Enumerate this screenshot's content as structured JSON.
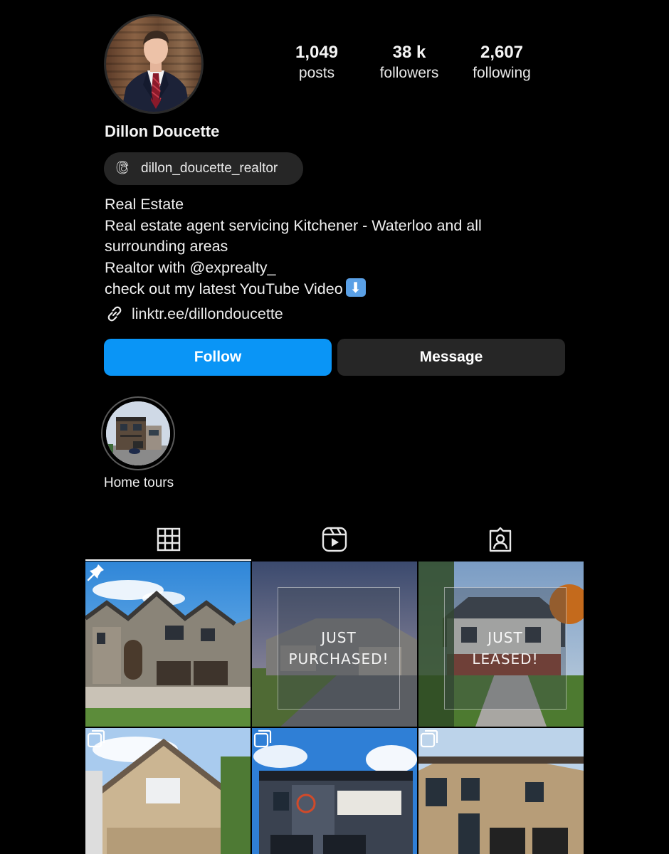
{
  "profile": {
    "name": "Dillon Doucette",
    "stats": [
      {
        "value": "1,049",
        "label": "posts"
      },
      {
        "value": "38 k",
        "label": "followers"
      },
      {
        "value": "2,607",
        "label": "following"
      }
    ],
    "threads_handle": "dillon_doucette_realtor",
    "bio_lines": [
      "Real Estate",
      "Real estate agent servicing Kitchener - Waterloo and all",
      "surrounding areas",
      "Realtor with @exprealty_",
      "check out my latest YouTube Video"
    ],
    "link": "linktr.ee/dillondoucette"
  },
  "actions": {
    "follow_label": "Follow",
    "message_label": "Message"
  },
  "highlights": [
    {
      "label": "Home tours"
    }
  ],
  "tabs": [
    {
      "icon": "grid-icon",
      "active": true
    },
    {
      "icon": "reels-icon",
      "active": false
    },
    {
      "icon": "tagged-icon",
      "active": false
    }
  ],
  "posts": [
    {
      "overlay": [],
      "badge": "pin-icon"
    },
    {
      "overlay": [
        "JUST",
        "PURCHASED!"
      ],
      "badge": ""
    },
    {
      "overlay": [
        "JUST",
        "LEASED!"
      ],
      "badge": ""
    },
    {
      "overlay": [],
      "badge": "carousel-icon"
    },
    {
      "overlay": [],
      "badge": "carousel-icon"
    },
    {
      "overlay": [],
      "badge": "carousel-icon"
    }
  ],
  "colors": {
    "background": "#000000",
    "follow_button": "#0a95f6",
    "secondary_button": "#262626"
  }
}
